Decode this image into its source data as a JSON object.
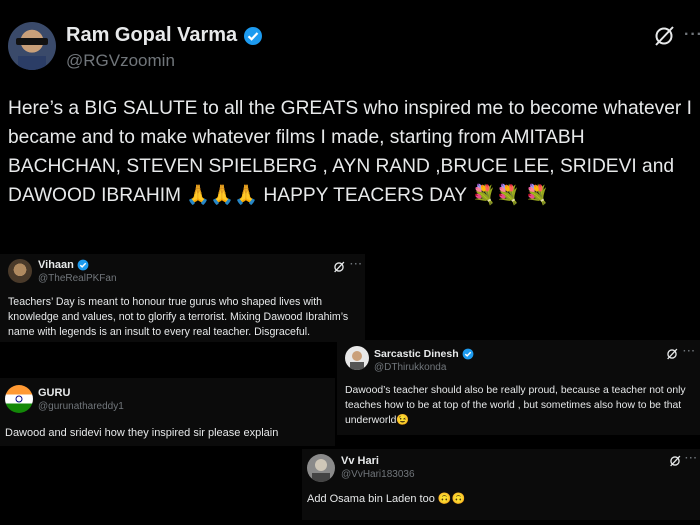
{
  "main_tweet": {
    "name": "Ram Gopal Varma",
    "handle": "@RGVzoomin",
    "text": "Here’s a BIG SALUTE to all the GREATS  who inspired me to become whatever I became and to make whatever films I made,  starting from AMITABH BACHCHAN, STEVEN SPIELBERG , AYN RAND ,BRUCE LEE, SRIDEVI and DAWOOD IBRAHIM",
    "emoji_pray": "🙏🙏🙏",
    "text_tail": "HAPPY TEACERS DAY",
    "emoji_flowers": "💐💐",
    "emoji_flower_last": "💐",
    "more": "···"
  },
  "replies": [
    {
      "name": "Vihaan",
      "handle": "@TheRealPKFan",
      "text": "Teachers’ Day is meant to honour true gurus who shaped lives with knowledge and values, not to glorify a terrorist. Mixing Dawood Ibrahim’s name with legends is an insult to every real teacher. Disgraceful.",
      "verified": true
    },
    {
      "name": "Sarcastic Dinesh",
      "handle": "@DThirukkonda",
      "text": "Dawood’s teacher should also be really proud, because a teacher not only teaches how to be at top of  the world , but sometimes also how to be that underworld",
      "emoji": "😉",
      "verified": true,
      "more": "···"
    },
    {
      "name": "GURU",
      "handle": "@gurunathareddy1",
      "text": "Dawood and sridevi how they inspired sir please explain",
      "verified": false
    },
    {
      "name": "Vv Hari",
      "handle": "@VvHari183036",
      "text": "Add Osama bin Laden too",
      "emoji": "🙃🙃",
      "verified": false,
      "more": "···"
    }
  ],
  "colors": {
    "background": "#000000",
    "text": "#e7e9ea",
    "muted": "#71767b",
    "verified": "#1d9bf0"
  }
}
